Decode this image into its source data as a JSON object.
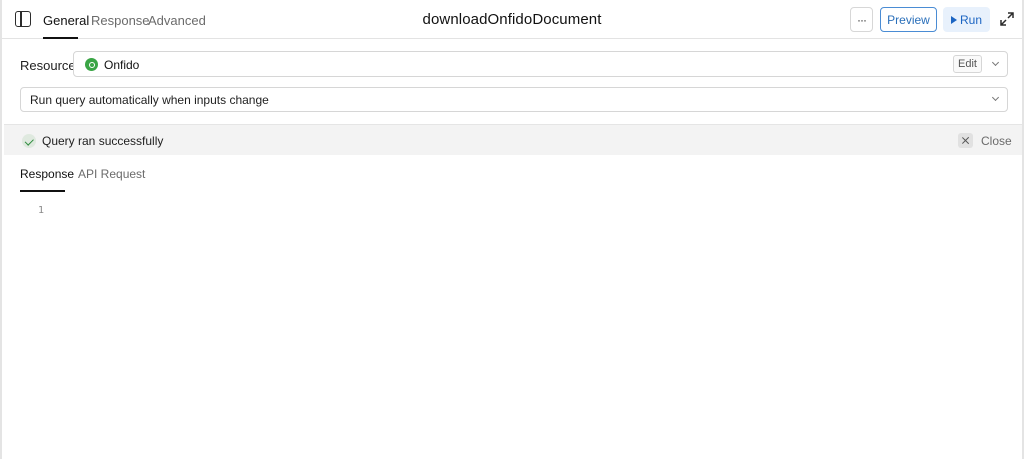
{
  "header": {
    "tabs": [
      {
        "label": "General"
      },
      {
        "label": "Response"
      },
      {
        "label": "Advanced"
      }
    ],
    "query_name": "downloadOnfidoDocument",
    "more_label": "···",
    "preview_label": "Preview",
    "run_label": "Run"
  },
  "resource": {
    "label": "Resource",
    "selected": "Onfido",
    "edit_label": "Edit",
    "icon": "onfido-logo-icon",
    "icon_color": "#3aa545"
  },
  "trigger": {
    "selected": "Run query automatically when inputs change"
  },
  "status": {
    "message": "Query ran successfully",
    "close_label": "Close",
    "success_color": "#2e8b3e"
  },
  "output": {
    "tabs": [
      {
        "label": "Response"
      },
      {
        "label": "API Request"
      }
    ],
    "line_numbers": [
      "1"
    ]
  },
  "colors": {
    "accent": "#1b64c2",
    "preview_border": "#4a8cd4",
    "run_bg": "#e8f1fc"
  }
}
